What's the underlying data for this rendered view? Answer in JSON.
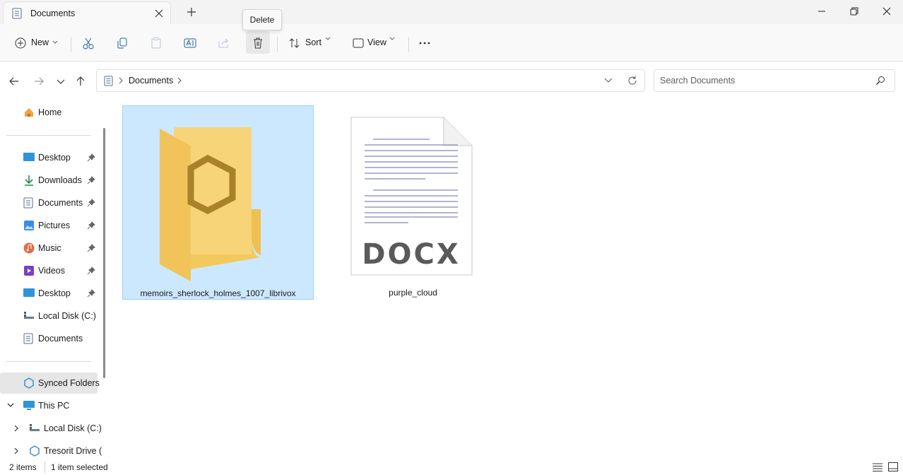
{
  "window": {
    "tab_title": "Documents",
    "tab_icon": "documents-icon",
    "close_tab_icon": "close-icon",
    "new_tab_icon": "plus-icon"
  },
  "toolbar": {
    "new_label": "New",
    "sort_label": "Sort",
    "view_label": "View",
    "tooltip": "Delete",
    "icons": [
      "cut-icon",
      "copy-icon",
      "paste-icon",
      "rename-icon",
      "share-icon",
      "delete-icon",
      "more-icon"
    ]
  },
  "address": {
    "crumb": "Documents",
    "search_placeholder": "Search Documents"
  },
  "sidebar": {
    "home": "Home",
    "quick": [
      {
        "label": "Desktop",
        "icon": "desktop-icon"
      },
      {
        "label": "Downloads",
        "icon": "download-icon"
      },
      {
        "label": "Documents",
        "icon": "documents-icon"
      },
      {
        "label": "Pictures",
        "icon": "pictures-icon"
      },
      {
        "label": "Music",
        "icon": "music-icon"
      },
      {
        "label": "Videos",
        "icon": "videos-icon"
      },
      {
        "label": "Desktop",
        "icon": "desktop-icon"
      }
    ],
    "local_disk": "Local Disk (C:)",
    "documents": "Documents",
    "synced": "Synced Folders",
    "this_pc": "This PC",
    "pc_local_disk": "Local Disk (C:)",
    "tresorit": "Tresorit Drive ("
  },
  "files": [
    {
      "name": "memoirs_sherlock_holmes_1007_librivox",
      "type": "folder",
      "selected": true
    },
    {
      "name": "purple_cloud",
      "type": "docx",
      "selected": false,
      "badge": "DOCX"
    }
  ],
  "status": {
    "count": "2 items",
    "selection": "1 item selected"
  },
  "colors": {
    "selection_bg": "#cce8ff",
    "selection_border": "#99d1ff",
    "folder": "#f7cf6a",
    "accent": "#0067c0"
  }
}
